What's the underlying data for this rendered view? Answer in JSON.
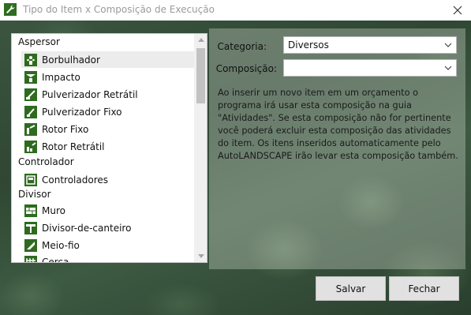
{
  "window": {
    "title": "Tipo do Item x Composição de Execução",
    "close_icon": "close-icon",
    "app_icon": "wrench-icon"
  },
  "list": {
    "groups": [
      {
        "label": "Aspersor",
        "items": [
          {
            "label": "Borbulhador",
            "icon": "bubbler-icon",
            "selected": true
          },
          {
            "label": "Impacto",
            "icon": "impact-sprinkler-icon"
          },
          {
            "label": "Pulverizador Retrátil",
            "icon": "retractable-sprayer-icon"
          },
          {
            "label": "Pulverizador Fixo",
            "icon": "fixed-sprayer-icon"
          },
          {
            "label": "Rotor Fixo",
            "icon": "fixed-rotor-icon"
          },
          {
            "label": "Rotor Retrátil",
            "icon": "retractable-rotor-icon"
          }
        ]
      },
      {
        "label": "Controlador",
        "items": [
          {
            "label": "Controladores",
            "icon": "controller-icon"
          }
        ]
      },
      {
        "label": "Divisor",
        "items": [
          {
            "label": "Muro",
            "icon": "wall-icon"
          },
          {
            "label": "Divisor-de-canteiro",
            "icon": "bed-divider-icon"
          },
          {
            "label": "Meio-fio",
            "icon": "curb-icon"
          },
          {
            "label": "Cerca",
            "icon": "fence-icon"
          }
        ]
      }
    ]
  },
  "form": {
    "categoria_label": "Categoria:",
    "categoria_value": "Diversos",
    "composicao_label": "Composição:",
    "composicao_value": ""
  },
  "description": "Ao inserir um novo item em um orçamento o programa irá usar esta composição na guia \"Atividades\". Se esta composição não for pertinente você poderá excluir esta composição das atividades do item. Os itens inseridos automaticamente pelo AutoLANDSCAPE irão levar esta composição também.",
  "buttons": {
    "save": "Salvar",
    "close": "Fechar"
  },
  "colors": {
    "accent_green": "#2e6b1f",
    "background": "#3b5540"
  }
}
